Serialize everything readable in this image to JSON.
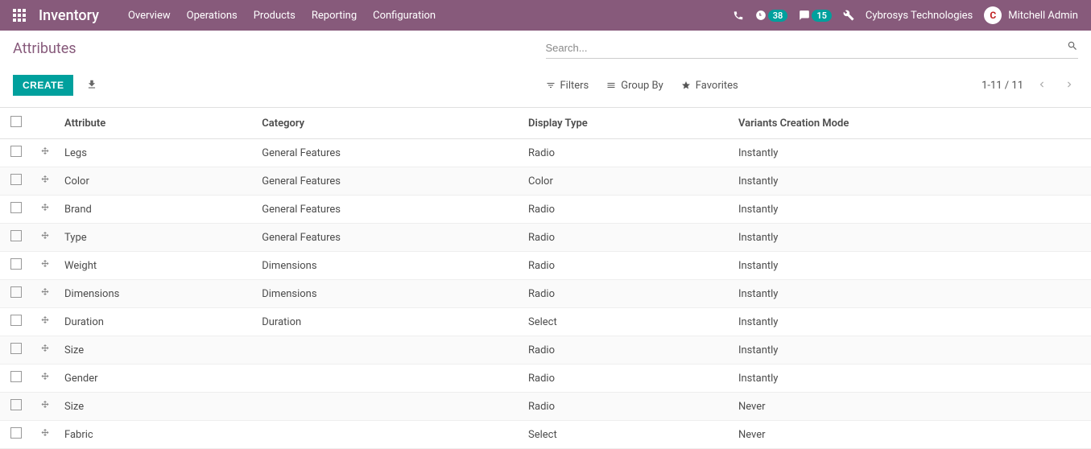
{
  "nav": {
    "app_title": "Inventory",
    "items": [
      "Overview",
      "Operations",
      "Products",
      "Reporting",
      "Configuration"
    ],
    "calendar_badge": "38",
    "messages_badge": "15",
    "company": "Cybrosys Technologies",
    "user": "Mitchell Admin",
    "avatar_letter": "C"
  },
  "breadcrumb": "Attributes",
  "search": {
    "placeholder": "Search..."
  },
  "buttons": {
    "create": "CREATE"
  },
  "search_options": {
    "filters": "Filters",
    "group_by": "Group By",
    "favorites": "Favorites"
  },
  "pager": {
    "range": "1-11 / 11"
  },
  "table": {
    "headers": {
      "attribute": "Attribute",
      "category": "Category",
      "display_type": "Display Type",
      "variants_mode": "Variants Creation Mode"
    },
    "rows": [
      {
        "attribute": "Legs",
        "category": "General Features",
        "display_type": "Radio",
        "variants_mode": "Instantly"
      },
      {
        "attribute": "Color",
        "category": "General Features",
        "display_type": "Color",
        "variants_mode": "Instantly"
      },
      {
        "attribute": "Brand",
        "category": "General Features",
        "display_type": "Radio",
        "variants_mode": "Instantly"
      },
      {
        "attribute": "Type",
        "category": "General Features",
        "display_type": "Radio",
        "variants_mode": "Instantly"
      },
      {
        "attribute": "Weight",
        "category": "Dimensions",
        "display_type": "Radio",
        "variants_mode": "Instantly"
      },
      {
        "attribute": "Dimensions",
        "category": "Dimensions",
        "display_type": "Radio",
        "variants_mode": "Instantly"
      },
      {
        "attribute": "Duration",
        "category": "Duration",
        "display_type": "Select",
        "variants_mode": "Instantly"
      },
      {
        "attribute": "Size",
        "category": "",
        "display_type": "Radio",
        "variants_mode": "Instantly"
      },
      {
        "attribute": "Gender",
        "category": "",
        "display_type": "Radio",
        "variants_mode": "Instantly"
      },
      {
        "attribute": "Size",
        "category": "",
        "display_type": "Radio",
        "variants_mode": "Never"
      },
      {
        "attribute": "Fabric",
        "category": "",
        "display_type": "Select",
        "variants_mode": "Never"
      }
    ]
  }
}
